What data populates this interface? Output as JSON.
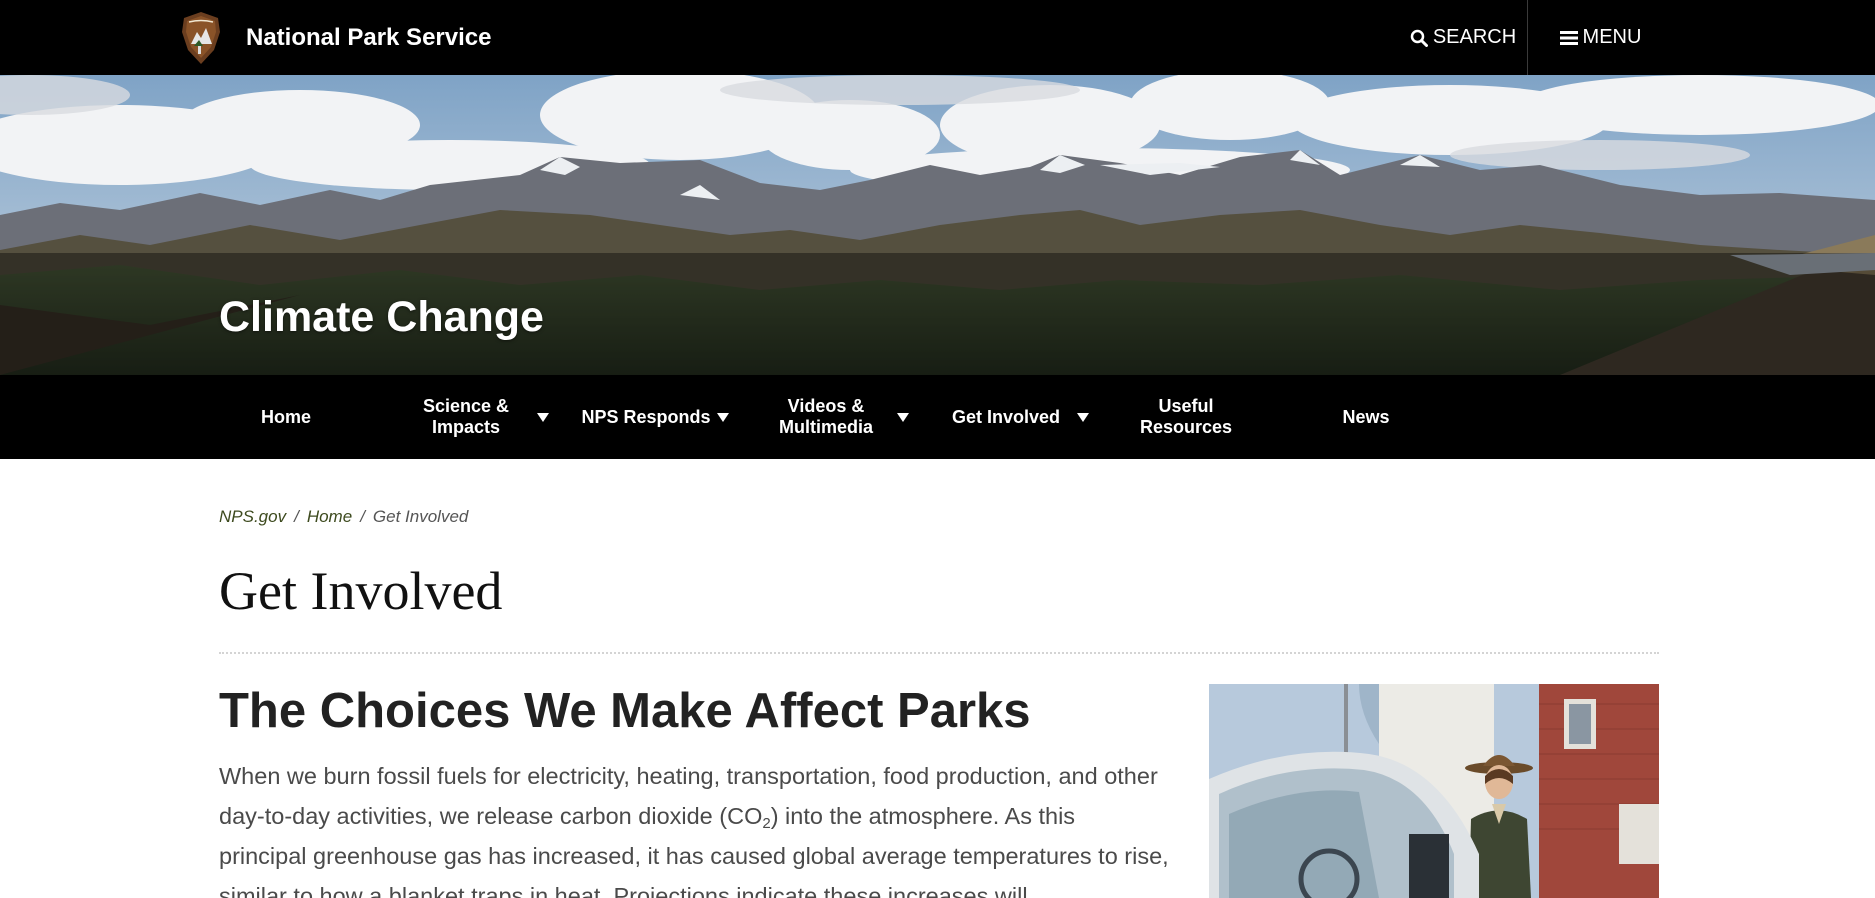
{
  "header": {
    "site_name": "National Park Service",
    "logo_icon": "nps-arrowhead-icon",
    "search_label": "SEARCH",
    "menu_label": "MENU",
    "colors": {
      "bar": "#000000",
      "text": "#ffffff"
    }
  },
  "hero": {
    "title": "Climate Change"
  },
  "nav": {
    "items": [
      {
        "label": "Home",
        "has_dropdown": false
      },
      {
        "label": "Science & Impacts",
        "has_dropdown": true
      },
      {
        "label": "NPS Responds",
        "has_dropdown": true
      },
      {
        "label": "Videos & Multimedia",
        "has_dropdown": true
      },
      {
        "label": "Get Involved",
        "has_dropdown": true
      },
      {
        "label": "Useful Resources",
        "has_dropdown": false
      },
      {
        "label": "News",
        "has_dropdown": false
      }
    ]
  },
  "breadcrumb": {
    "items": [
      "NPS.gov",
      "Home",
      "Get Involved"
    ],
    "separator": "/"
  },
  "page": {
    "title": "Get Involved"
  },
  "article": {
    "heading": "The Choices We Make Affect Parks",
    "body_part1": "When we burn fossil fuels for electricity, heating, transportation, food production, and other day-to-day activities, we release carbon dioxide (CO",
    "body_sub": "2",
    "body_part2": ") into the atmosphere. As this principal greenhouse gas has increased, it has caused global average temperatures to rise, similar to how a blanket traps in heat. Projections indicate these increases will"
  },
  "colors": {
    "breadcrumb_link": "#3d4a1e",
    "body_text": "#4a4a4a",
    "heading": "#222222"
  }
}
